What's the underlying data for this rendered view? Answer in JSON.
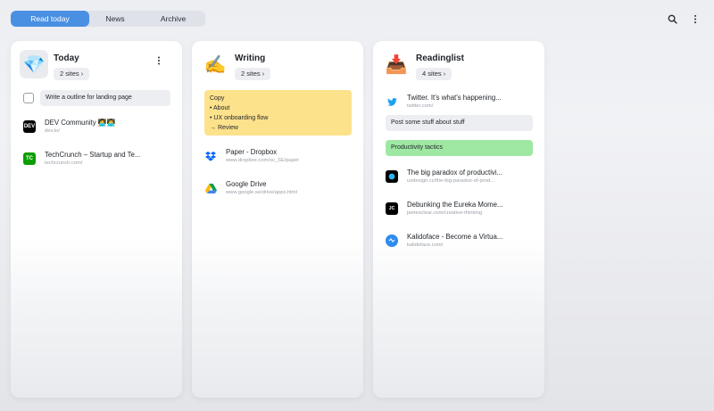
{
  "tabs": [
    {
      "label": "Read today",
      "active": true
    },
    {
      "label": "News",
      "active": false
    },
    {
      "label": "Archive",
      "active": false
    }
  ],
  "top_icons": [
    "search-icon",
    "more-vertical-icon"
  ],
  "cards": [
    {
      "title": "Today",
      "emoji": "💎",
      "sites_label": "2 sites ›",
      "todo": "Write a outline for landing page",
      "sites": [
        {
          "title": "DEV Community 👩‍💻👨‍💻",
          "url": "dev.to/",
          "icon": "DEV"
        },
        {
          "title": "TechCrunch – Startup and Te...",
          "url": "techcrunch.com/",
          "icon": "TC"
        }
      ]
    },
    {
      "title": "Writing",
      "emoji": "✍️",
      "sites_label": "2 sites ›",
      "note_lines": [
        "Copy",
        "• About",
        "• UX onboarding flow",
        "→ Review"
      ],
      "sites": [
        {
          "title": "Paper - Dropbox",
          "url": "www.dropbox.com/sv_SE/paper",
          "icon": "dropbox"
        },
        {
          "title": "Google Drive",
          "url": "www.google.se/drive/apps.html",
          "icon": "drive"
        }
      ]
    },
    {
      "title": "Readinglist",
      "emoji": "📥",
      "sites_label": "4 sites ›",
      "sites": [
        {
          "title": "Twitter. It's what's happening...",
          "url": "twitter.com/",
          "icon": "twitter"
        },
        {
          "title": "The big paradox of productivi...",
          "url": "uxdesign.cc/the-big-paradox-of-prod...",
          "icon": "uxdesign"
        },
        {
          "title": "Debunking the Eureka Mome...",
          "url": "jamesclear.com/creative-thinking",
          "icon": "JC"
        },
        {
          "title": "Kalidoface - Become a Virtua...",
          "url": "kalidoface.com/",
          "icon": "kalidoface"
        }
      ],
      "note_gray": "Post some stuff about stuff",
      "note_green": "Productivity tactics"
    }
  ]
}
